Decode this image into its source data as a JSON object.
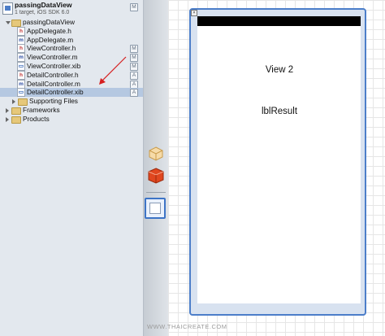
{
  "project": {
    "name": "passingDataView",
    "subtitle": "1 target, iOS SDK 6.0",
    "badge": "M"
  },
  "navigator": {
    "items": [
      {
        "label": "passingDataView",
        "kind": "folder",
        "disclosure": "open",
        "badge": ""
      },
      {
        "label": "AppDelegate.h",
        "kind": "h",
        "badge": ""
      },
      {
        "label": "AppDelegate.m",
        "kind": "m",
        "badge": ""
      },
      {
        "label": "ViewController.h",
        "kind": "h",
        "badge": "M"
      },
      {
        "label": "ViewController.m",
        "kind": "m",
        "badge": "M"
      },
      {
        "label": "ViewController.xib",
        "kind": "xib",
        "badge": "M"
      },
      {
        "label": "DetailController.h",
        "kind": "h",
        "badge": "A"
      },
      {
        "label": "DetailController.m",
        "kind": "m",
        "badge": "A"
      },
      {
        "label": "DetailController.xib",
        "kind": "xib",
        "badge": "A",
        "selected": true
      },
      {
        "label": "Supporting Files",
        "kind": "folder",
        "disclosure": "closed",
        "badge": ""
      },
      {
        "label": "Frameworks",
        "kind": "folder",
        "disclosure": "closed",
        "badge": ""
      },
      {
        "label": "Products",
        "kind": "folder",
        "disclosure": "closed",
        "badge": ""
      }
    ]
  },
  "canvas": {
    "view_title": "View 2",
    "label_text": "lblResult",
    "close_glyph": "×"
  },
  "library": {
    "icons": [
      "object-cube-icon",
      "red-cube-icon",
      "view-object-icon"
    ]
  },
  "watermark": "WWW.THAICREATE.COM",
  "colors": {
    "selection": "#b5c8e1",
    "frame": "#4c7ec9",
    "arrow": "#d62020"
  }
}
